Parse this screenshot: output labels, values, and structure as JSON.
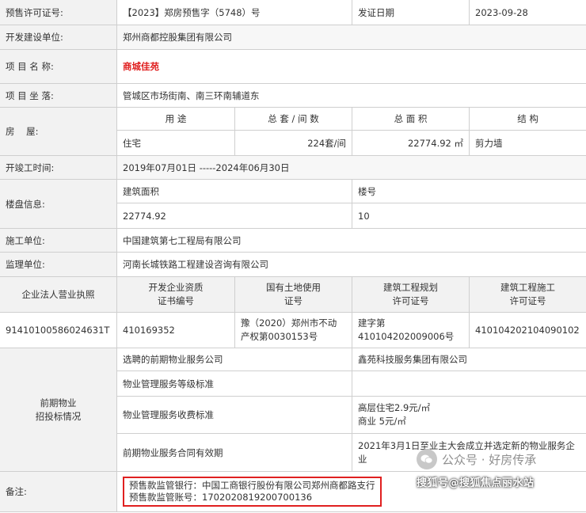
{
  "presale": {
    "permit_label": "预售许可证号:",
    "permit_no": "【2023】郑房预售字（5748）号",
    "issue_date_label": "发证日期",
    "issue_date": "2023-09-28"
  },
  "developer": {
    "label": "开发建设单位:",
    "value": "郑州商都控股集团有限公司"
  },
  "project": {
    "name_label": "项 目 名 称:",
    "name": "商城佳苑",
    "location_label": "项 目 坐 落:",
    "location": "管城区市场街南、南三环南辅道东"
  },
  "housing": {
    "label": "房    屋:",
    "headers": [
      "用 途",
      "总 套 / 间 数",
      "总 面 积",
      "结 构"
    ],
    "row": [
      "住宅",
      "224套/间",
      "22774.92 ㎡",
      "剪力墙"
    ]
  },
  "schedule": {
    "label": "开竣工时间:",
    "value": "2019年07月01日 -----2024年06月30日"
  },
  "building_info": {
    "label": "楼盘信息:",
    "area_label": "建筑面积",
    "area": "22774.92",
    "bldg_label": "楼号",
    "bldg": "10"
  },
  "construction": {
    "label": "施工单位:",
    "value": "中国建筑第七工程局有限公司"
  },
  "supervision": {
    "label": "监理单位:",
    "value": "河南长城铁路工程建设咨询有限公司"
  },
  "licenses": {
    "headers": [
      "企业法人营业执照",
      "开发企业资质\n证书编号",
      "国有土地使用\n证号",
      "建筑工程规划\n许可证号",
      "建筑工程施工\n许可证号"
    ],
    "values": [
      "91410100586024631T",
      "410169352",
      "豫（2020）郑州市不动\n产权第0030153号",
      "建字第\n410104202009006号",
      "410104202104090102"
    ]
  },
  "property": {
    "label": "前期物业\n招投标情况",
    "rows": [
      {
        "label": "选聘的前期物业服务公司",
        "value": "鑫苑科技服务集团有限公司"
      },
      {
        "label": "物业管理服务等级标准",
        "value": ""
      },
      {
        "label": "物业管理服务收费标准",
        "value": "高层住宅2.9元/㎡\n商业 5元/㎡"
      },
      {
        "label": "前期物业服务合同有效期",
        "value": "2021年3月1日至业主大会成立并选定新的物业服务企\n业"
      }
    ]
  },
  "remark": {
    "label": "备注:",
    "bank_line": "预售款监管银行：中国工商银行股份有限公司郑州商都路支行",
    "account_line": "预售款监管账号：1702020819200700136"
  },
  "watermark": {
    "top": "公众号 · 好房传承",
    "bottom": "搜狐号@搜狐焦点丽水站"
  },
  "colors": {
    "label_bg": "#f2f2f2",
    "border": "#cfcfcf",
    "highlight": "#e02020"
  }
}
